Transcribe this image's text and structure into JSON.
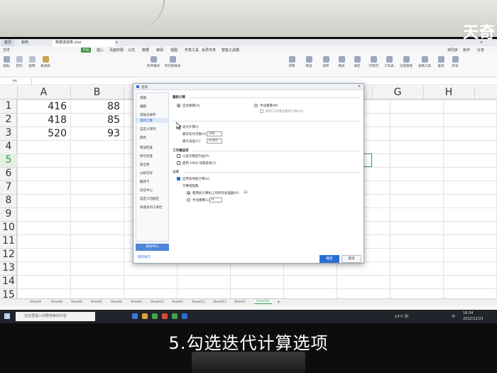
{
  "watermark": "天奇",
  "caption": "5.勾选迭代计算选项",
  "window": {
    "tabs": [
      "首页",
      "稻壳",
      "数据透视表.xlsx"
    ],
    "menus": [
      "文件",
      "开始",
      "插入",
      "页面布局",
      "公式",
      "数据",
      "审阅",
      "视图",
      "开发工具",
      "会员专享",
      "智能工具箱"
    ],
    "active_menu": "开始",
    "right_items": [
      "未同步",
      "协作",
      "分享"
    ]
  },
  "ribbon": {
    "left": [
      "粘贴",
      "剪切",
      "复制",
      "格式刷"
    ],
    "groups": [
      "条件格式",
      "单元格样式",
      "求和",
      "筛选",
      "排序",
      "格式",
      "填充",
      "行和列",
      "工作表",
      "冻结窗格",
      "表格工具",
      "查找",
      "符号"
    ]
  },
  "formula_bar": {
    "cell": "F5"
  },
  "sheet": {
    "columns": [
      "A",
      "B",
      "C",
      "D",
      "E",
      "F",
      "G",
      "H"
    ],
    "rows": [
      "1",
      "2",
      "3",
      "4",
      "5",
      "6",
      "7",
      "8",
      "9",
      "10",
      "11",
      "12",
      "13",
      "14",
      "15"
    ],
    "cells": [
      [
        "416",
        "88"
      ],
      [
        "418",
        "85"
      ],
      [
        "520",
        "93"
      ]
    ]
  },
  "sheet_tabs": [
    "Sheet9",
    "Sheet8",
    "Sheet6",
    "Sheet5",
    "Sheet4",
    "Sheet3",
    "Sheet12",
    "Sheet2",
    "Sheet11",
    "Sheet13",
    "Sheet7",
    "Sheet10"
  ],
  "active_sheet": "Sheet10",
  "dialog": {
    "title": "选项",
    "nav": [
      "视图",
      "编辑",
      "常规与保存",
      "重新计算",
      "自定义序列",
      "颜色",
      "错误检查",
      "拼写检查",
      "安全性",
      "分析向导",
      "翻译卡",
      "信任中心",
      "自定义功能区",
      "快速访问工具栏"
    ],
    "nav_selected": "重新计算",
    "backup_button": "备份中心",
    "tips_link": "操作技巧",
    "recalc": {
      "section": "重新计算",
      "auto": "自动重算(A)",
      "manual": "手动重算(M)",
      "save_before": "保存工作簿前重新计算(W)"
    },
    "iteration": {
      "checkbox": "迭代计算(I)",
      "max_iter_label": "最多迭代次数(X):",
      "max_iter_value": "100",
      "max_change_label": "最大误差(C):",
      "max_change_value": "0.001"
    },
    "workbook": {
      "section": "工作簿选项",
      "precision": "以显示精度为准(P)",
      "date1904": "使用 1904 日期系统(Y)"
    },
    "formula": {
      "section": "公式",
      "multithread": "启用多线程计算(U)",
      "threads_label": "计算线程数",
      "use_all": "使用此计算机上的所有处理器(P):",
      "cpu_count": "12",
      "manual_label": "手动重算(L):",
      "manual_value": "6"
    },
    "ok": "确定",
    "cancel": "取消"
  },
  "taskbar": {
    "search_placeholder": "在这里输入你要搜索的内容",
    "weather": "14°C 阴",
    "ime": "中",
    "time": "18:34",
    "date": "2022/12/21"
  }
}
